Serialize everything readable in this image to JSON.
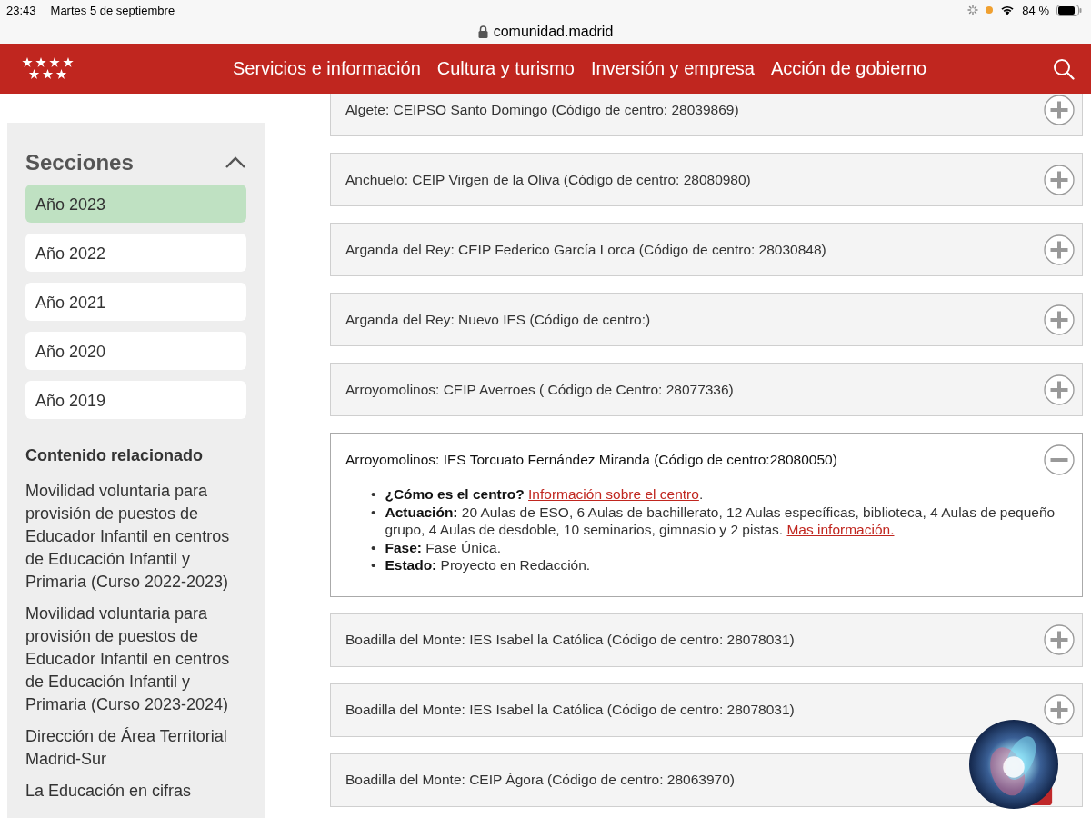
{
  "status_bar": {
    "time": "23:43",
    "date": "Martes 5 de septiembre",
    "battery": "84 %"
  },
  "browser": {
    "url": "comunidad.madrid"
  },
  "site_header": {
    "nav": [
      "Servicios e información",
      "Cultura y turismo",
      "Inversión y empresa",
      "Acción de gobierno"
    ]
  },
  "sidebar": {
    "title": "Secciones",
    "expanded": true,
    "sections": [
      {
        "label": "Año 2023",
        "selected": true
      },
      {
        "label": "Año 2022",
        "selected": false
      },
      {
        "label": "Año 2021",
        "selected": false
      },
      {
        "label": "Año 2020",
        "selected": false
      },
      {
        "label": "Año 2019",
        "selected": false
      }
    ],
    "related_title": "Contenido relacionado",
    "related_links": [
      "Movilidad voluntaria para provisión de puestos de Educador Infantil en centros de Educación Infantil y Primaria (Curso 2022-2023)",
      "Movilidad voluntaria para provisión de puestos de Educador Infantil en centros de Educación Infantil y Primaria (Curso 2023-2024)",
      "Dirección de Área Territorial Madrid-Sur",
      "La Educación en cifras"
    ]
  },
  "centers": [
    {
      "title": "Algete: CEIPSO Santo Domingo (Código de centro: 28039869)",
      "expanded": false
    },
    {
      "title": "Anchuelo: CEIP Virgen de la Oliva (Código de centro: 28080980)",
      "expanded": false
    },
    {
      "title": "Arganda del Rey: CEIP Federico García Lorca (Código de centro: 28030848)",
      "expanded": false
    },
    {
      "title": "Arganda del Rey: Nuevo IES (Código de centro:)",
      "expanded": false
    },
    {
      "title": "Arroyomolinos: CEIP Averroes ( Código de Centro: 28077336)",
      "expanded": false
    },
    {
      "title": "Arroyomolinos: IES Torcuato Fernández Miranda (Código de centro:28080050)",
      "expanded": true,
      "details": [
        {
          "bullet": "•",
          "text": "**¿Cómo es el centro?** ",
          "link": "Información sobre el centro",
          "tail": "."
        },
        {
          "bullet": "•",
          "text": "**Actuación:**  20 Aulas de ESO, 6 Aulas de bachillerato, 12 Aulas específicas, biblioteca, 4 Aulas de pequeño grupo, 4 Aulas de desdoble, 10 seminarios, gimnasio y 2 pistas. ",
          "link": "Mas información."
        },
        {
          "bullet": "•",
          "text": "**Fase:**  Fase Única."
        },
        {
          "bullet": "•",
          "text": "**Estado:** Proyecto en Redacción."
        }
      ]
    },
    {
      "title": "Boadilla del Monte: IES Isabel la Católica (Código de centro: 28078031)",
      "expanded": false
    },
    {
      "title": "Boadilla del Monte: IES Isabel la Católica (Código de centro: 28078031)",
      "expanded": false
    },
    {
      "title": "Boadilla del Monte: CEIP Ágora (Código de centro: 28063970)"
    }
  ]
}
